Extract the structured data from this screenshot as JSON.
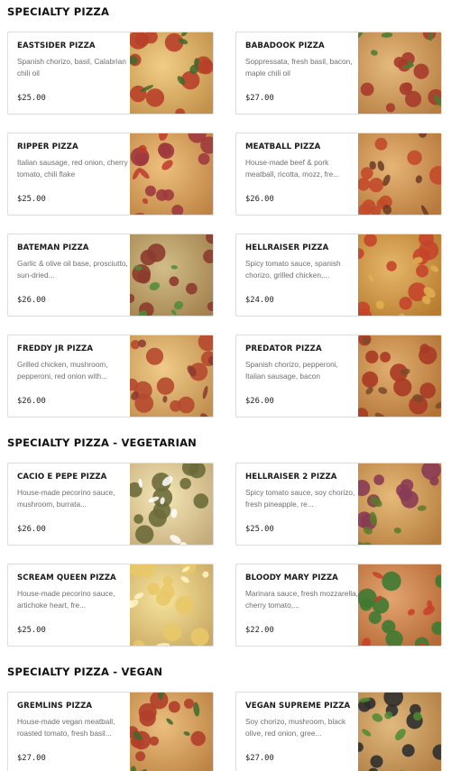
{
  "sections": [
    {
      "title": "SPECIALTY PIZZA",
      "items": [
        {
          "name": "EASTSIDER PIZZA",
          "desc": "Spanish chorizo, basil, Calabrian chili oil",
          "price": "$25.00",
          "image": "pizza-eastsider-image"
        },
        {
          "name": "BABADOOK PIZZA",
          "desc": "Soppressata, fresh basil, bacon, maple chili oil",
          "price": "$27.00",
          "image": "pizza-babadook-image"
        },
        {
          "name": "RIPPER PIZZA",
          "desc": "Italian sausage, red onion, cherry tomato, chili flake",
          "price": "$25.00",
          "image": "pizza-ripper-image"
        },
        {
          "name": "MEATBALL PIZZA",
          "desc": "House-made beef & pork meatball, ricotta, mozz, fre...",
          "price": "$26.00",
          "image": "pizza-meatball-image"
        },
        {
          "name": "BATEMAN PIZZA",
          "desc": "Garlic & olive oil base, prosciutto, sun-dried...",
          "price": "$26.00",
          "image": "pizza-bateman-image"
        },
        {
          "name": "HELLRAISER PIZZA",
          "desc": "Spicy tomato sauce, spanish chorizo, grilled chicken,...",
          "price": "$24.00",
          "image": "pizza-hellraiser-image"
        },
        {
          "name": "FREDDY JR PIZZA",
          "desc": "Grilled chicken, mushroom, pepperoni, red onion with...",
          "price": "$26.00",
          "image": "pizza-freddy-jr-image"
        },
        {
          "name": "PREDATOR PIZZA",
          "desc": "Spanish chorizo, pepperoni, Italian sausage, bacon",
          "price": "$26.00",
          "image": "pizza-predator-image"
        }
      ]
    },
    {
      "title": "SPECIALTY PIZZA - VEGETARIAN",
      "items": [
        {
          "name": "CACIO E PEPE PIZZA",
          "desc": "House-made pecorino sauce, mushroom, burrata...",
          "price": "$26.00",
          "image": "pizza-cacio-e-pepe-image"
        },
        {
          "name": "HELLRAISER 2 PIZZA",
          "desc": "Spicy tomato sauce, soy chorizo, fresh pineapple, re...",
          "price": "$25.00",
          "image": "pizza-hellraiser-2-image"
        },
        {
          "name": "SCREAM QUEEN PIZZA",
          "desc": "House-made pecorino sauce, artichoke heart, fre...",
          "price": "$25.00",
          "image": "pizza-scream-queen-image"
        },
        {
          "name": "BLOODY MARY PIZZA",
          "desc": "Marinara sauce, fresh mozzarella, cherry tomato,...",
          "price": "$22.00",
          "image": "pizza-bloody-mary-image"
        }
      ]
    },
    {
      "title": "SPECIALTY PIZZA - VEGAN",
      "items": [
        {
          "name": "GREMLINS PIZZA",
          "desc": "House-made vegan meatball, roasted tomato, fresh basil...",
          "price": "$27.00",
          "image": "pizza-gremlins-image"
        },
        {
          "name": "VEGAN SUPREME PIZZA",
          "desc": "Soy chorizo, mushroom, black olive, red onion, gree...",
          "price": "$27.00",
          "image": "pizza-vegan-supreme-image"
        }
      ]
    }
  ],
  "colors": {
    "crust": "#d9a35c",
    "cheese": "#f1d28a",
    "sauce": "#c8452a",
    "pepperoni": "#b23a22",
    "basil": "#3e6b2a"
  }
}
